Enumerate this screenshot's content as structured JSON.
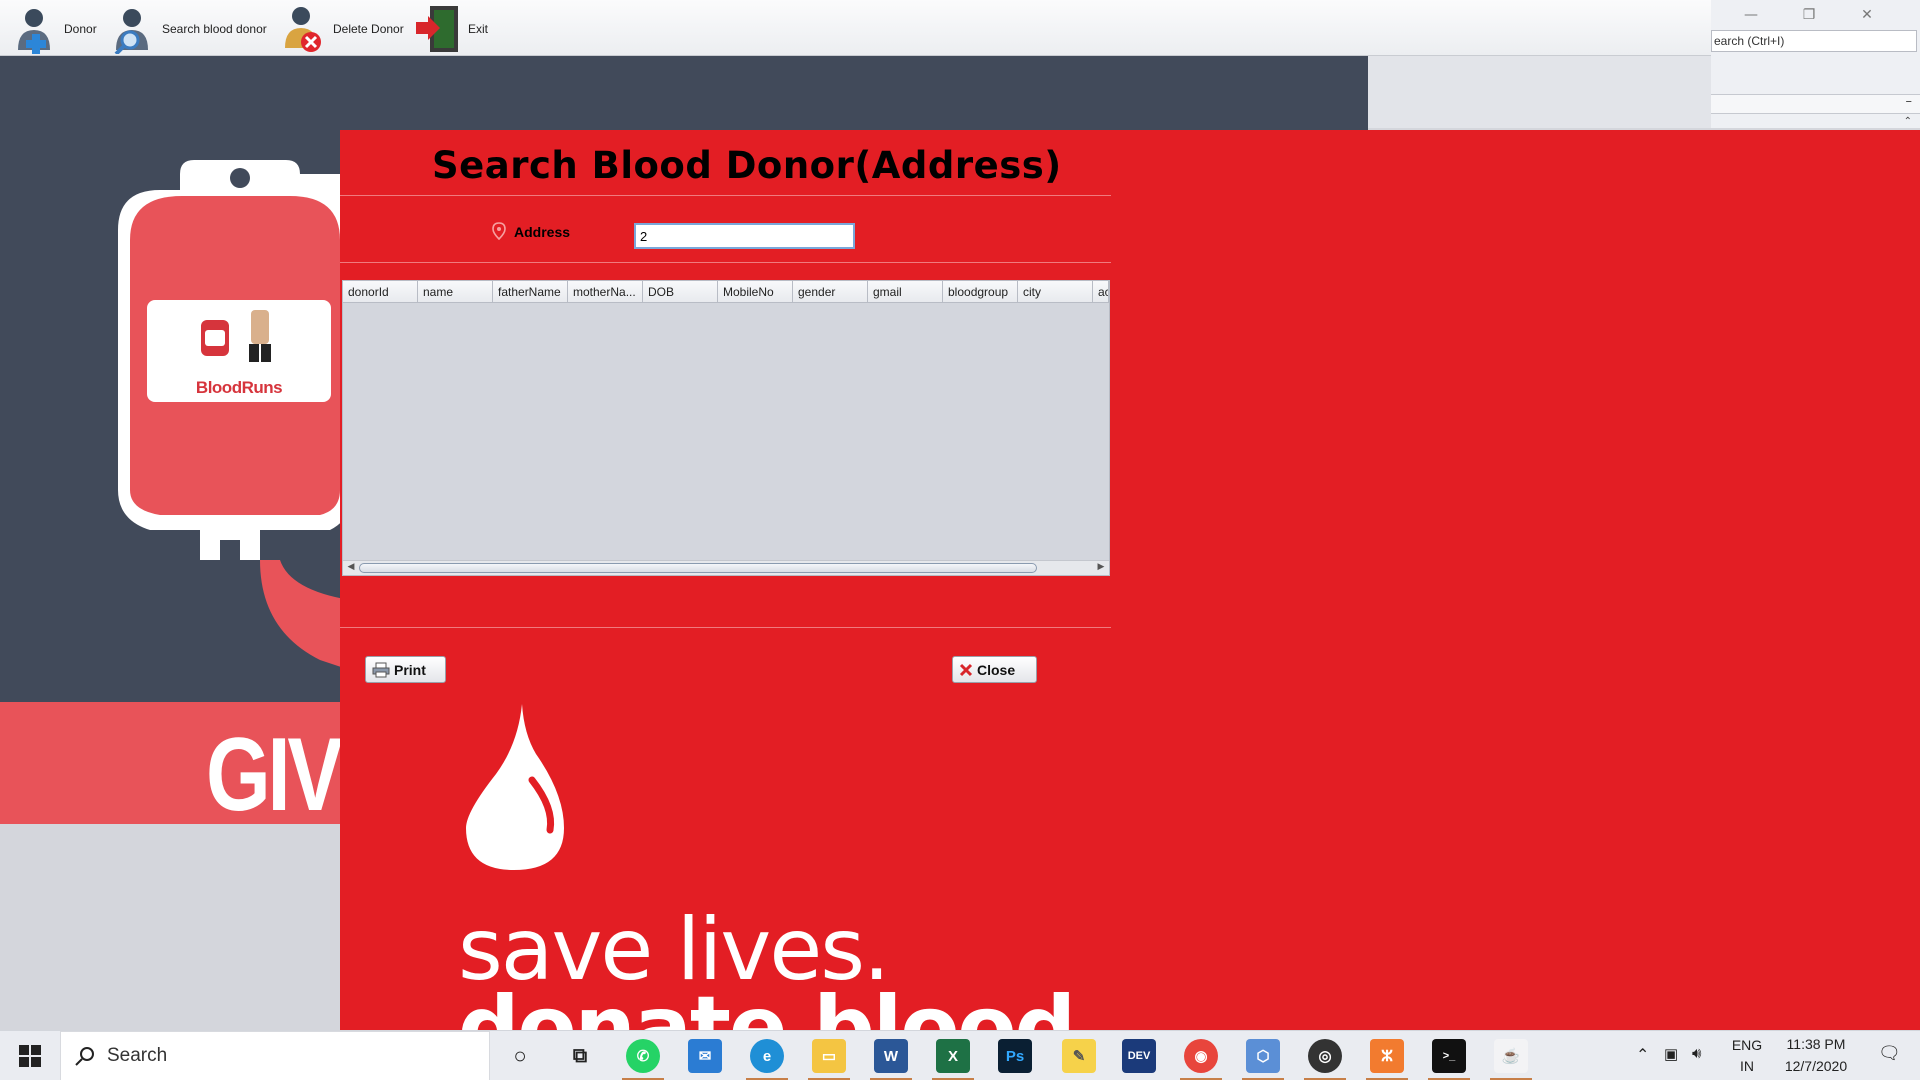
{
  "toolbar": {
    "items": [
      {
        "label": "Donor",
        "icon": "add-donor-icon"
      },
      {
        "label": "Search blood donor",
        "icon": "search-donor-icon"
      },
      {
        "label": "Delete Donor",
        "icon": "delete-donor-icon"
      },
      {
        "label": "Exit",
        "icon": "exit-door-icon"
      }
    ]
  },
  "ide": {
    "search_placeholder": "Search (Ctrl+I)",
    "search_visible": "earch (Ctrl+I)"
  },
  "poster": {
    "giv": "GIV",
    "logo_text": "BloodRuns",
    "line1": "save lives.",
    "line2": "donate blood"
  },
  "dialog": {
    "title": "Search Blood Donor(Address)",
    "address_label": "Address",
    "address_value": "2",
    "columns": [
      "donorId",
      "name",
      "fatherName",
      "motherNa...",
      "DOB",
      "MobileNo",
      "gender",
      "gmail",
      "bloodgroup",
      "city",
      "ac"
    ],
    "rows": [],
    "print_label": "Print",
    "close_label": "Close"
  },
  "taskbar": {
    "search_text": "Search",
    "apps": [
      "cortana-icon",
      "task-view-icon",
      "whatsapp-icon",
      "mail-icon",
      "edge-icon",
      "file-explorer-icon",
      "word-icon",
      "excel-icon",
      "photoshop-icon",
      "notes-icon",
      "devcpp-icon",
      "chrome-icon",
      "virtualbox-icon",
      "media-icon",
      "xampp-icon",
      "terminal-icon",
      "java-icon"
    ],
    "lang1": "ENG",
    "lang2": "IN",
    "time": "11:38 PM",
    "date": "12/7/2020"
  },
  "colors": {
    "dialog_red": "#e31e24",
    "poster_dark": "#414a5a",
    "poster_band": "#e85359"
  }
}
